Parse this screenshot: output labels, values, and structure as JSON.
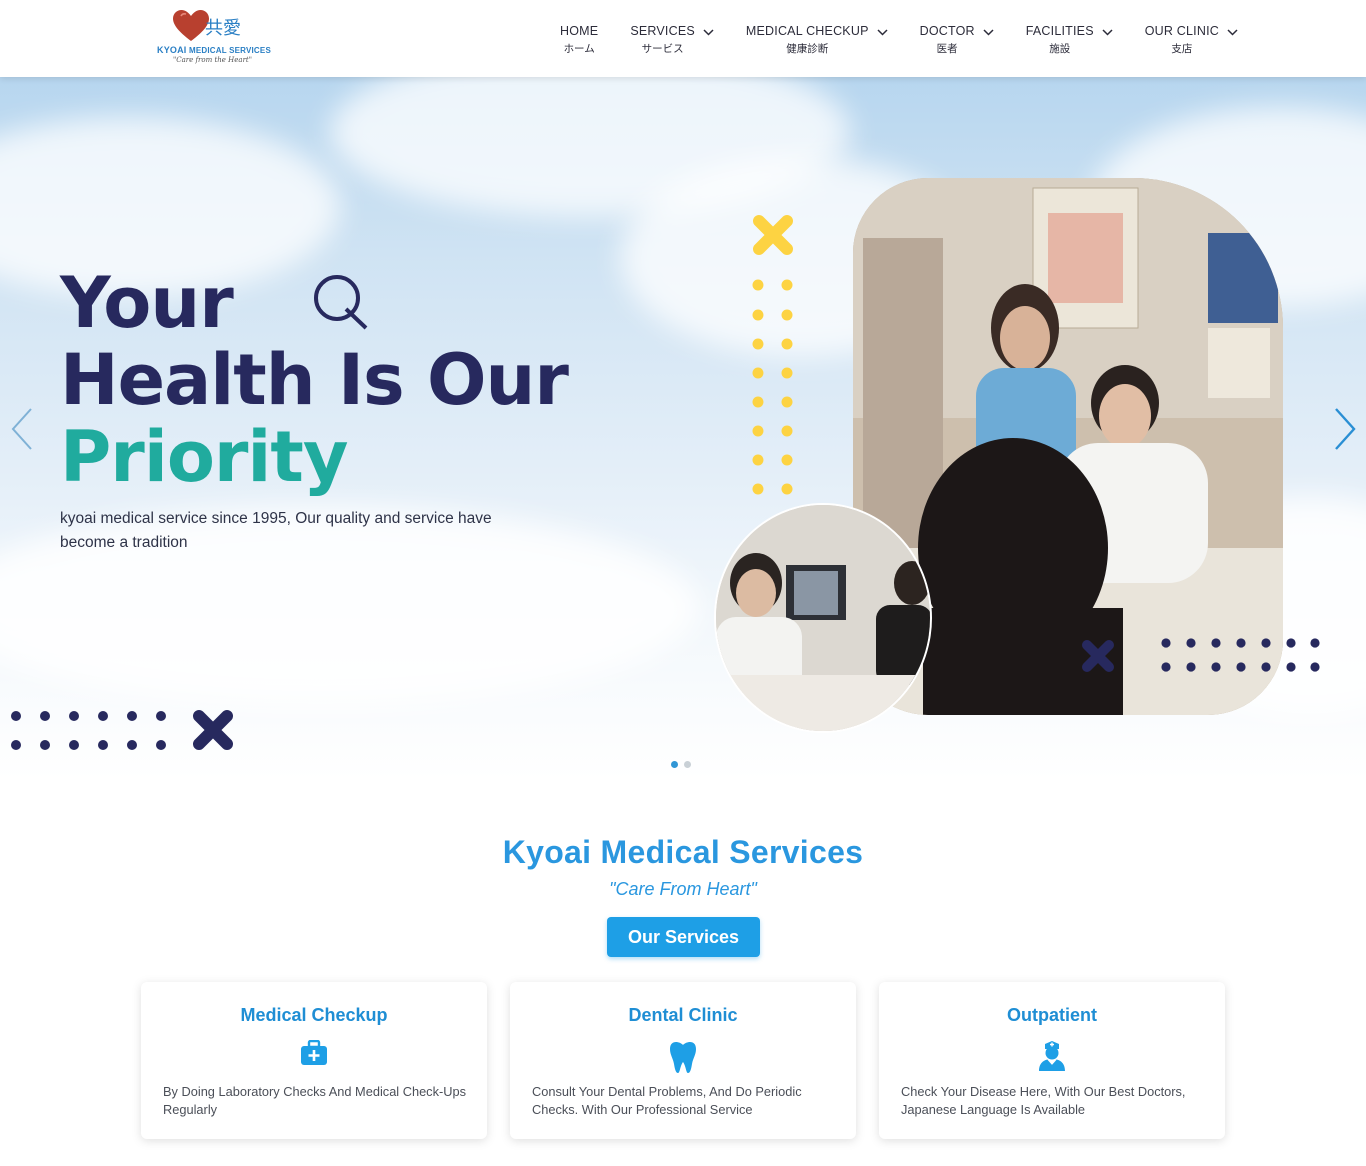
{
  "header": {
    "logo": {
      "kanji": "共愛",
      "brand_bold": "KYOAI",
      "brand_rest": "MEDICAL SERVICES",
      "motto": "\"Care from the Heart\""
    },
    "nav": [
      {
        "en": "HOME",
        "jp": "ホーム",
        "dropdown": false
      },
      {
        "en": "SERVICES",
        "jp": "サービス",
        "dropdown": true
      },
      {
        "en": "MEDICAL CHECKUP",
        "jp": "健康診断",
        "dropdown": true
      },
      {
        "en": "DOCTOR",
        "jp": "医者",
        "dropdown": true
      },
      {
        "en": "FACILITIES",
        "jp": "施設",
        "dropdown": true
      },
      {
        "en": "OUR CLINIC",
        "jp": "支店",
        "dropdown": true
      }
    ]
  },
  "hero": {
    "title_line1": "Your",
    "title_line2": "Health Is Our",
    "title_line3": "Priority",
    "subtitle": "kyoai medical service since 1995, Our quality and service have become a tradition",
    "slide_count": 2,
    "active_slide": 1,
    "colors": {
      "navy": "#27295e",
      "teal": "#20ab9e",
      "yellow": "#fdd342"
    }
  },
  "services": {
    "title": "Kyoai Medical Services",
    "motto": "\"Care From Heart\"",
    "button": "Our Services",
    "cards": [
      {
        "title": "Medical Checkup",
        "icon": "medical-kit-icon",
        "desc": "By Doing Laboratory Checks And Medical Check-Ups Regularly"
      },
      {
        "title": "Dental Clinic",
        "icon": "tooth-icon",
        "desc": "Consult Your Dental Problems, And Do Periodic Checks. With Our Professional Service"
      },
      {
        "title": "Outpatient",
        "icon": "doctor-icon",
        "desc": "Check Your Disease Here, With Our Best Doctors, Japanese Language Is Available"
      }
    ],
    "accent": "#1e9fe6"
  }
}
